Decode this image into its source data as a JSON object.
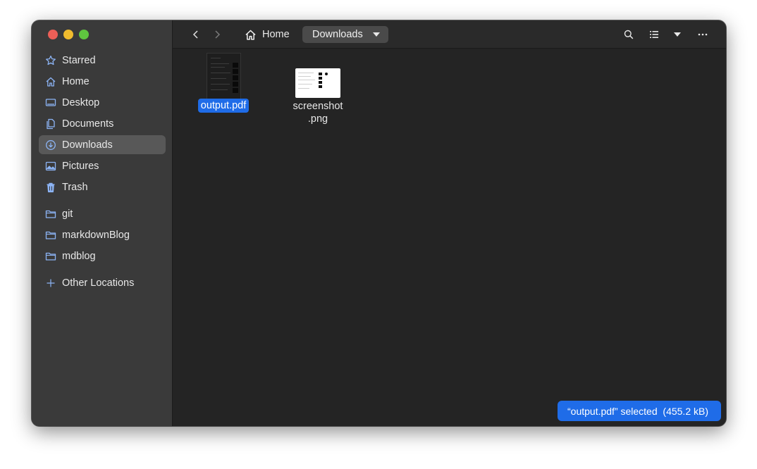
{
  "sidebar": {
    "places": [
      {
        "label": "Starred",
        "icon": "star-icon"
      },
      {
        "label": "Home",
        "icon": "home-icon"
      },
      {
        "label": "Desktop",
        "icon": "desktop-icon"
      },
      {
        "label": "Documents",
        "icon": "documents-icon"
      },
      {
        "label": "Downloads",
        "icon": "download-icon",
        "active": true
      },
      {
        "label": "Pictures",
        "icon": "pictures-icon"
      },
      {
        "label": "Trash",
        "icon": "trash-icon"
      }
    ],
    "bookmarks": [
      {
        "label": "git",
        "icon": "folder-icon"
      },
      {
        "label": "markdownBlog",
        "icon": "folder-icon"
      },
      {
        "label": "mdblog",
        "icon": "folder-icon"
      }
    ],
    "other": {
      "label": "Other Locations",
      "icon": "plus-icon"
    }
  },
  "header": {
    "home_label": "Home",
    "current_folder": "Downloads"
  },
  "files": [
    {
      "name": "output.pdf",
      "selected": true
    },
    {
      "name_line1": "screenshot",
      "name_line2": ".png"
    }
  ],
  "status": {
    "text": "“output.pdf” selected  (455.2 kB)"
  },
  "colors": {
    "accent": "#1f6ce8",
    "sidebar_bg": "#3a3a3a",
    "content_bg": "#242424",
    "icon_blue": "#8cb4f5"
  }
}
